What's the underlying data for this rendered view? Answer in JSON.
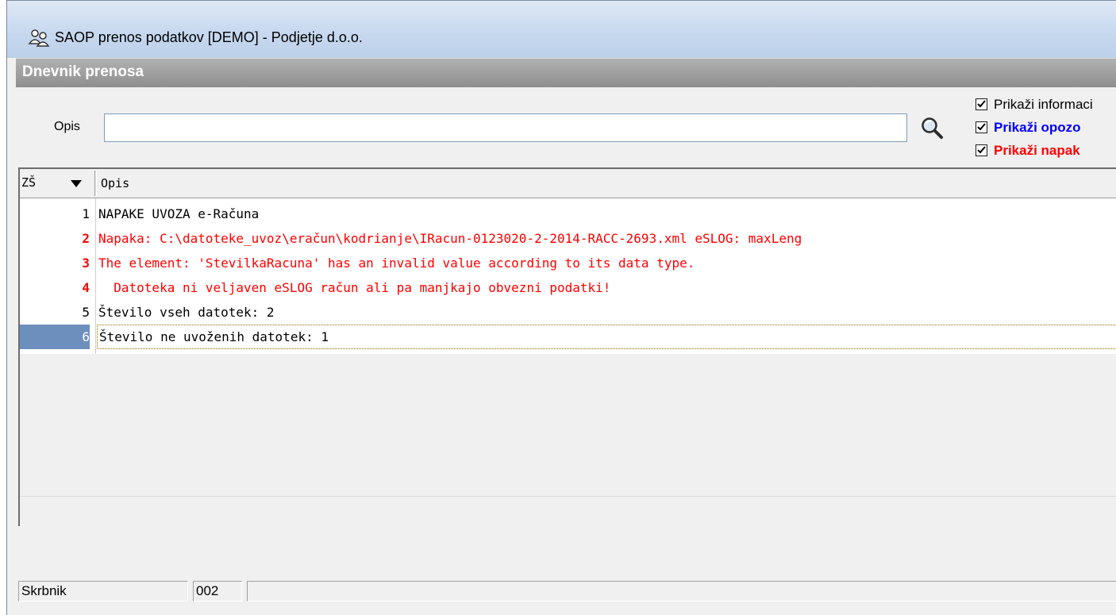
{
  "window": {
    "title": "SAOP prenos podatkov [DEMO] - Podjetje d.o.o.",
    "app_icon": "users-icon"
  },
  "section": {
    "title": "Dnevnik prenosa"
  },
  "filter": {
    "label": "Opis",
    "value": "",
    "search_icon": "magnifier-icon"
  },
  "options": [
    {
      "label": "Prikaži informaci",
      "checked": true,
      "color": "#000000"
    },
    {
      "label": "Prikaži opozo",
      "checked": true,
      "color": "#0000ff"
    },
    {
      "label": "Prikaži napak",
      "checked": true,
      "color": "#ff0000"
    }
  ],
  "grid": {
    "columns": {
      "zs": "ZŠ",
      "opis": "Opis",
      "sort_icon": "sort-descending-icon"
    },
    "rows": [
      {
        "num": "1",
        "text": "NAPAKE UVOZA e-Računa",
        "type": "info"
      },
      {
        "num": "2",
        "text": "Napaka: C:\\datoteke_uvoz\\eračun\\kodrianje\\IRacun-0123020-2-2014-RACC-2693.xml eSLOG: maxLeng",
        "type": "error"
      },
      {
        "num": "3",
        "text": "The element: 'StevilkaRacuna'  has an invalid value according to its data type.",
        "type": "error"
      },
      {
        "num": "4",
        "text": "  Datoteka ni veljaven eSLOG račun ali pa manjkajo obvezni podatki!",
        "type": "error"
      },
      {
        "num": "5",
        "text": "Število vseh datotek: 2",
        "type": "info"
      },
      {
        "num": "6",
        "text": "Število ne uvoženih datotek: 1",
        "type": "info",
        "selected": true
      }
    ]
  },
  "statusbar": {
    "user": "Skrbnik",
    "code": "002",
    "message": ""
  }
}
